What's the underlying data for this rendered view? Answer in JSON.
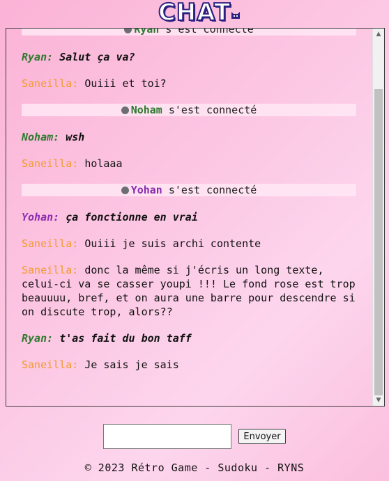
{
  "header": {
    "logo_text": "CHAT"
  },
  "chat": {
    "messages": [
      {
        "type": "notice",
        "user": "Ryan",
        "text": " s'est connecté"
      },
      {
        "type": "msg",
        "user": "Ryan:",
        "text": "Salut ça va?"
      },
      {
        "type": "msg",
        "user": "Saneilla:",
        "text": "Ouiii et toi?"
      },
      {
        "type": "notice",
        "user": "Noham",
        "text": " s'est connecté"
      },
      {
        "type": "msg",
        "user": "Noham:",
        "text": "wsh"
      },
      {
        "type": "msg",
        "user": "Saneilla:",
        "text": "holaaa"
      },
      {
        "type": "notice",
        "user": "Yohan",
        "text": " s'est connecté"
      },
      {
        "type": "msg",
        "user": "Yohan:",
        "text": "ça fonctionne en vrai"
      },
      {
        "type": "msg",
        "user": "Saneilla:",
        "text": "Ouiii je suis archi contente"
      },
      {
        "type": "msg",
        "user": "Saneilla:",
        "text": "donc la même si j'écris un long texte, celui-ci va se casser youpi !!! Le fond rose est trop beauuuu, bref, et on aura une barre pour descendre si on discute trop, alors??"
      },
      {
        "type": "msg",
        "user": "Ryan:",
        "text": "t'as fait du bon taff"
      },
      {
        "type": "msg",
        "user": "Saneilla:",
        "text": "Je sais je sais"
      }
    ]
  },
  "form": {
    "input_value": "",
    "send_label": "Envoyer"
  },
  "footer": {
    "text": "© 2023 Rétro Game - Sudoku - RYNS"
  },
  "colors": {
    "green_user": "#2f7a2f",
    "purple_user": "#8a2db0",
    "orange_user": "#f39a2e"
  }
}
